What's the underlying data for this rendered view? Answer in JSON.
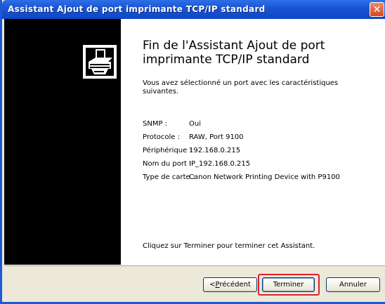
{
  "window": {
    "title": "Assistant Ajout de port imprimante TCP/IP standard",
    "close_glyph": "✕"
  },
  "main": {
    "heading": "Fin de l'Assistant Ajout de port imprimante TCP/IP standard",
    "intro": "Vous avez sélectionné un port avec les caractéristiques suivantes.",
    "properties": [
      {
        "label": "SNMP :",
        "value": "Oui"
      },
      {
        "label": "Protocole :",
        "value": "RAW, Port 9100"
      },
      {
        "label": "Périphérique :",
        "value": "192.168.0.215"
      },
      {
        "label": "Nom du port :",
        "value": "IP_192.168.0.215"
      },
      {
        "label": "Type de carte :",
        "value": "Canon Network Printing Device with P9100"
      }
    ],
    "finish_note": "Cliquez sur Terminer pour terminer cet Assistant."
  },
  "buttons": {
    "prev_arrow": "< ",
    "prev_accel": "P",
    "prev_rest": "récédent",
    "finish": "Terminer",
    "cancel": "Annuler"
  },
  "colors": {
    "titlebar": "#1a56d6",
    "highlight": "#e0212d",
    "sidebar": "#000000"
  },
  "icons": {
    "wizard": "printer-wizard-icon",
    "close": "close-icon"
  }
}
